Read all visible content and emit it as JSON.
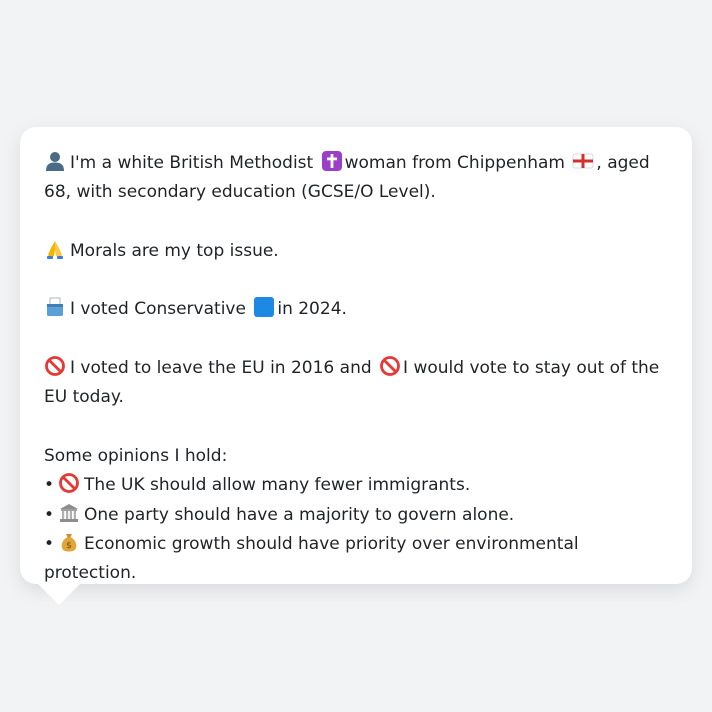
{
  "message": {
    "identity": {
      "part1": "I'm a white British Methodist",
      "part2": "woman from Chippenham",
      "part3": ", aged 68, with secondary education (GCSE/O Level)."
    },
    "top_issue": "Morals are my top issue.",
    "vote": {
      "part1": "I voted Conservative",
      "part2": "in 2024."
    },
    "eu": {
      "part1": "I voted to leave the EU in 2016 and",
      "part2": "I would vote to stay out of the EU today."
    },
    "opinions_heading": "Some opinions I hold:",
    "opinions": [
      {
        "bullet": "•",
        "text": "The UK should allow many fewer immigrants."
      },
      {
        "bullet": "•",
        "text": "One party should have a majority to govern alone."
      },
      {
        "bullet": "•",
        "text": "Economic growth should have priority over environmental protection."
      }
    ]
  },
  "icons": {
    "person": "person-silhouette-icon",
    "religion": "latin-cross-icon",
    "flag": "england-flag-icon",
    "pray": "folded-hands-icon",
    "ballot": "ballot-box-icon",
    "party": "blue-square-icon",
    "prohibited": "prohibited-icon",
    "government": "classical-building-icon",
    "money": "money-bag-icon"
  },
  "colors": {
    "background": "#f2f3f5",
    "bubble": "#ffffff",
    "text": "#1f2328",
    "party_blue": "#1e88e5"
  }
}
